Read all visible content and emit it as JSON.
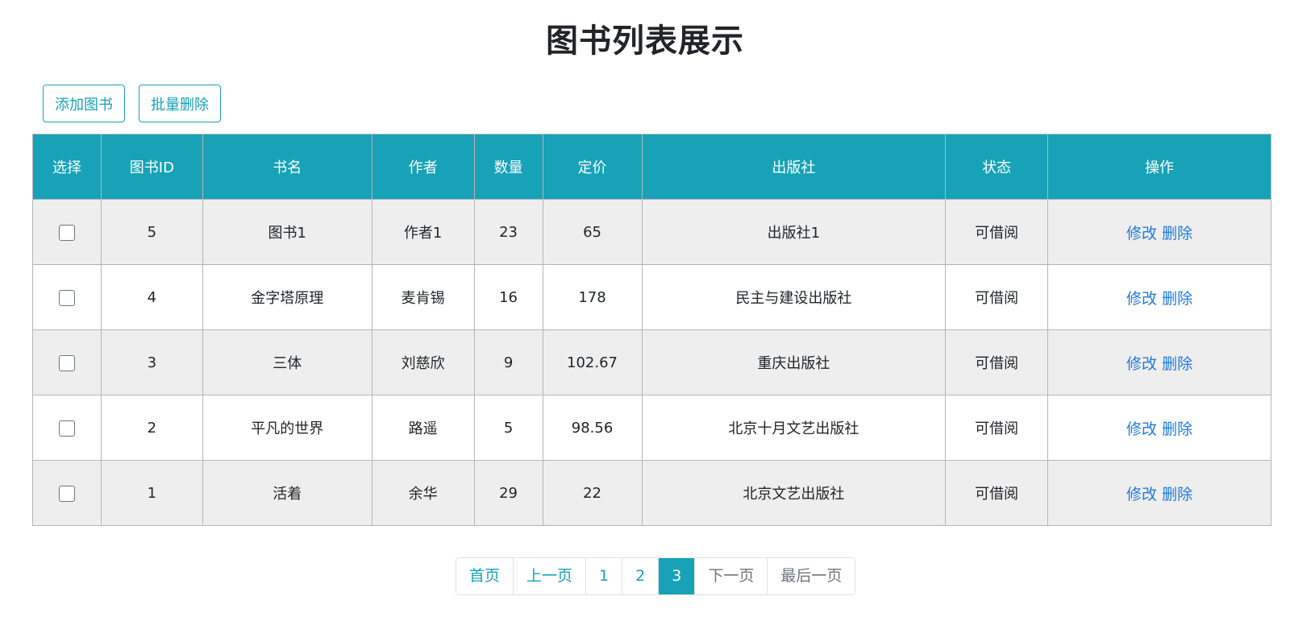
{
  "title": "图书列表展示",
  "toolbar": {
    "add_label": "添加图书",
    "batch_delete_label": "批量删除"
  },
  "table": {
    "headers": [
      "选择",
      "图书ID",
      "书名",
      "作者",
      "数量",
      "定价",
      "出版社",
      "状态",
      "操作"
    ],
    "rows": [
      {
        "checked": false,
        "id": "5",
        "name": "图书1",
        "author": "作者1",
        "quantity": "23",
        "price": "65",
        "publisher": "出版社1",
        "status": "可借阅"
      },
      {
        "checked": false,
        "id": "4",
        "name": "金字塔原理",
        "author": "麦肯锡",
        "quantity": "16",
        "price": "178",
        "publisher": "民主与建设出版社",
        "status": "可借阅"
      },
      {
        "checked": false,
        "id": "3",
        "name": "三体",
        "author": "刘慈欣",
        "quantity": "9",
        "price": "102.67",
        "publisher": "重庆出版社",
        "status": "可借阅"
      },
      {
        "checked": false,
        "id": "2",
        "name": "平凡的世界",
        "author": "路遥",
        "quantity": "5",
        "price": "98.56",
        "publisher": "北京十月文艺出版社",
        "status": "可借阅"
      },
      {
        "checked": false,
        "id": "1",
        "name": "活着",
        "author": "余华",
        "quantity": "29",
        "price": "22",
        "publisher": "北京文艺出版社",
        "status": "可借阅"
      }
    ],
    "edit_label": "修改",
    "delete_label": "删除"
  },
  "pagination": {
    "first": "首页",
    "prev": "上一页",
    "pages": [
      "1",
      "2",
      "3"
    ],
    "current": "3",
    "next": "下一页",
    "last": "最后一页"
  },
  "colors": {
    "accent": "#17a2b8",
    "link": "#1e7ae0",
    "row_stripe": "#eeeeee"
  }
}
